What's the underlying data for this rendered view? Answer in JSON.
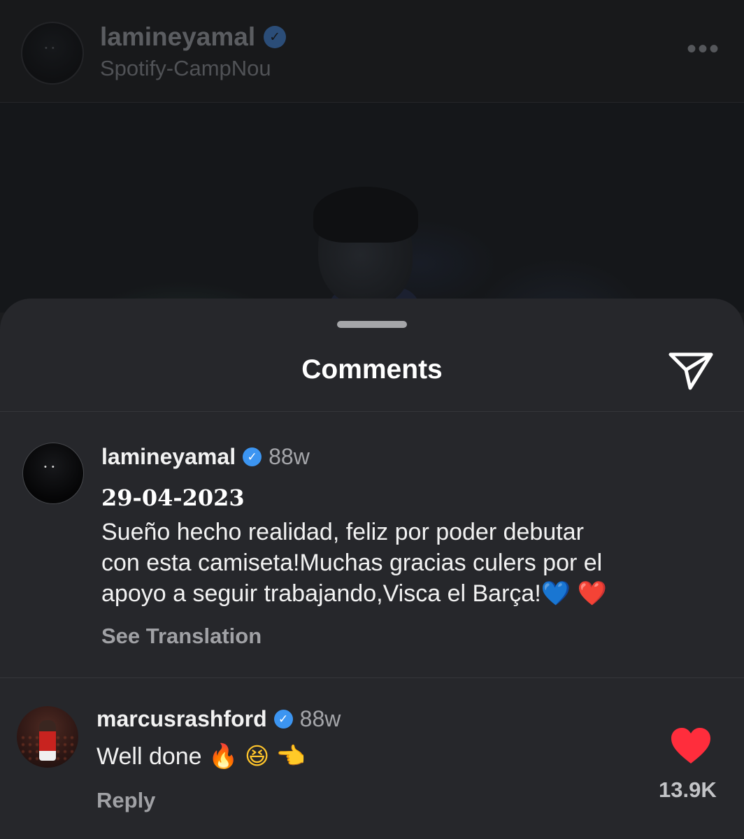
{
  "post": {
    "username": "lamineyamal",
    "location": "Spotify-CampNou"
  },
  "comments_sheet": {
    "title": "Comments"
  },
  "caption": {
    "username": "lamineyamal",
    "time": "88w",
    "date": "29-04-2023",
    "text_line1": "Sueño hecho realidad, feliz por poder debutar",
    "text_line2": "con esta camiseta!Muchas gracias culers por el",
    "text_line3": "apoyo a seguir trabajando,Visca el Barça!",
    "emoji_blue_heart": "💙",
    "emoji_red_heart": "❤️",
    "see_translation": "See Translation"
  },
  "comment": {
    "username": "marcusrashford",
    "time": "88w",
    "text": "Well done",
    "emoji_fire": "🔥",
    "emoji_laugh": "😆",
    "emoji_point": "👈",
    "reply_label": "Reply",
    "like_count": "13.9K",
    "liked": true
  },
  "colors": {
    "sheet_bg": "#26272b",
    "verified_blue": "#3c95f1",
    "like_red": "#ff2d3c"
  },
  "icons": [
    "verified-badge-icon",
    "more-icon",
    "send-icon",
    "heart-icon"
  ]
}
